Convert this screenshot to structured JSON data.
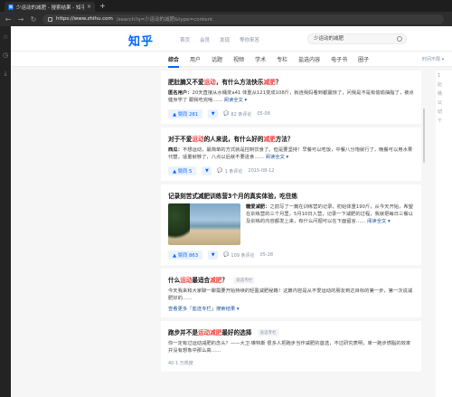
{
  "browser": {
    "tab_title": "少运动的减肥 - 搜索结果 - 知乎",
    "favicon": "知",
    "url_host": "https://www.zhihu.com",
    "url_path": "/search?q=少运动的减肥&type=content"
  },
  "header": {
    "logo": "知乎",
    "nav": [
      "首页",
      "会员",
      "发现",
      "等你来答"
    ],
    "search_value": "少运动的减肥"
  },
  "filters": {
    "tabs": [
      "综合",
      "用户",
      "话题",
      "视频",
      "学术",
      "专栏",
      "盐选内容",
      "电子书",
      "圈子"
    ],
    "time_filter": "时间不限 ▾"
  },
  "results": [
    {
      "title_a": "肥肚腩又不爱",
      "title_hl": "运动",
      "title_b": "，有什么方法快乐",
      "title_hl2": "减肥",
      "title_c": "？",
      "excerpt": "20天直接从水桶变a41 体重从121变成108斤，就连我妈看到都震惊了，问我是不是有偷偷抽脂了，被点健身学了 跟我吃完啥……",
      "author": "匿名用户：",
      "more": "阅读全文 ▾",
      "votes": "▲ 赞同 281",
      "comments": "82 条评论",
      "date": "05-08"
    },
    {
      "title_a": "对于不爱",
      "title_hl": "运动",
      "title_b": "的人来说，有什么好的",
      "title_hl2": "减肥",
      "title_c": "方法？",
      "excerpt": "不想运动，最简单的方式就是控制饮食了。但是要坚持！早餐可以吃饭，中餐八分饱就行了，晚餐可以用水果代替，适量就够了，八点以后就不要进食……",
      "author": "西瓜：",
      "more": "阅读全文 ▾",
      "votes": "▲ 赞同 5",
      "comments": "1 条评论",
      "date": "2015-08-12"
    },
    {
      "title": "记录刻苦式减肥训练营3个月的真实体验，吃住练",
      "excerpt": "之前写了一篇在训练营的记录，初始体重190斤，从今天开始，希望在训练营的三个月里，5月10日入营，记录一下减肥的过程，我就把每日三餐以及训练的内容都发上来，有什么问题可以在下面留言……",
      "author": "糖爱减肥：",
      "more": "阅读全文 ▾",
      "votes": "▲ 赞同 863",
      "comments": "109 条评论",
      "date": "05-28"
    },
    {
      "title_a": "什么",
      "title_hl": "运动",
      "title_b": "最适合",
      "title_hl2": "减肥",
      "title_c": "？",
      "tag": "盐选专栏",
      "excerpt": "今天我来和大家聊一聊需要开始持续的轻盈减肥秘籍！这篇内容是从不爱运动的朋友到达目标的第一步，第一次说减肥好的……",
      "more": "查看更多「盐选专栏」搜索结果 ▾"
    },
    {
      "title_a": "跑步并不是",
      "title_hl": "运动减肥",
      "title_b": "最好的选择",
      "tag": "盐选专栏",
      "excerpt": "你一定有过运动减肥的念头？——大卫·琳特斯 很多人把跑步当作减肥的首选，不过研究表明，单一跑步燃脂的效率并没有想象中那么高……",
      "more": "40.1 万热度"
    }
  ],
  "sidebar_partial": [
    "1",
    "比",
    "杨",
    "公",
    "切",
    "个"
  ]
}
